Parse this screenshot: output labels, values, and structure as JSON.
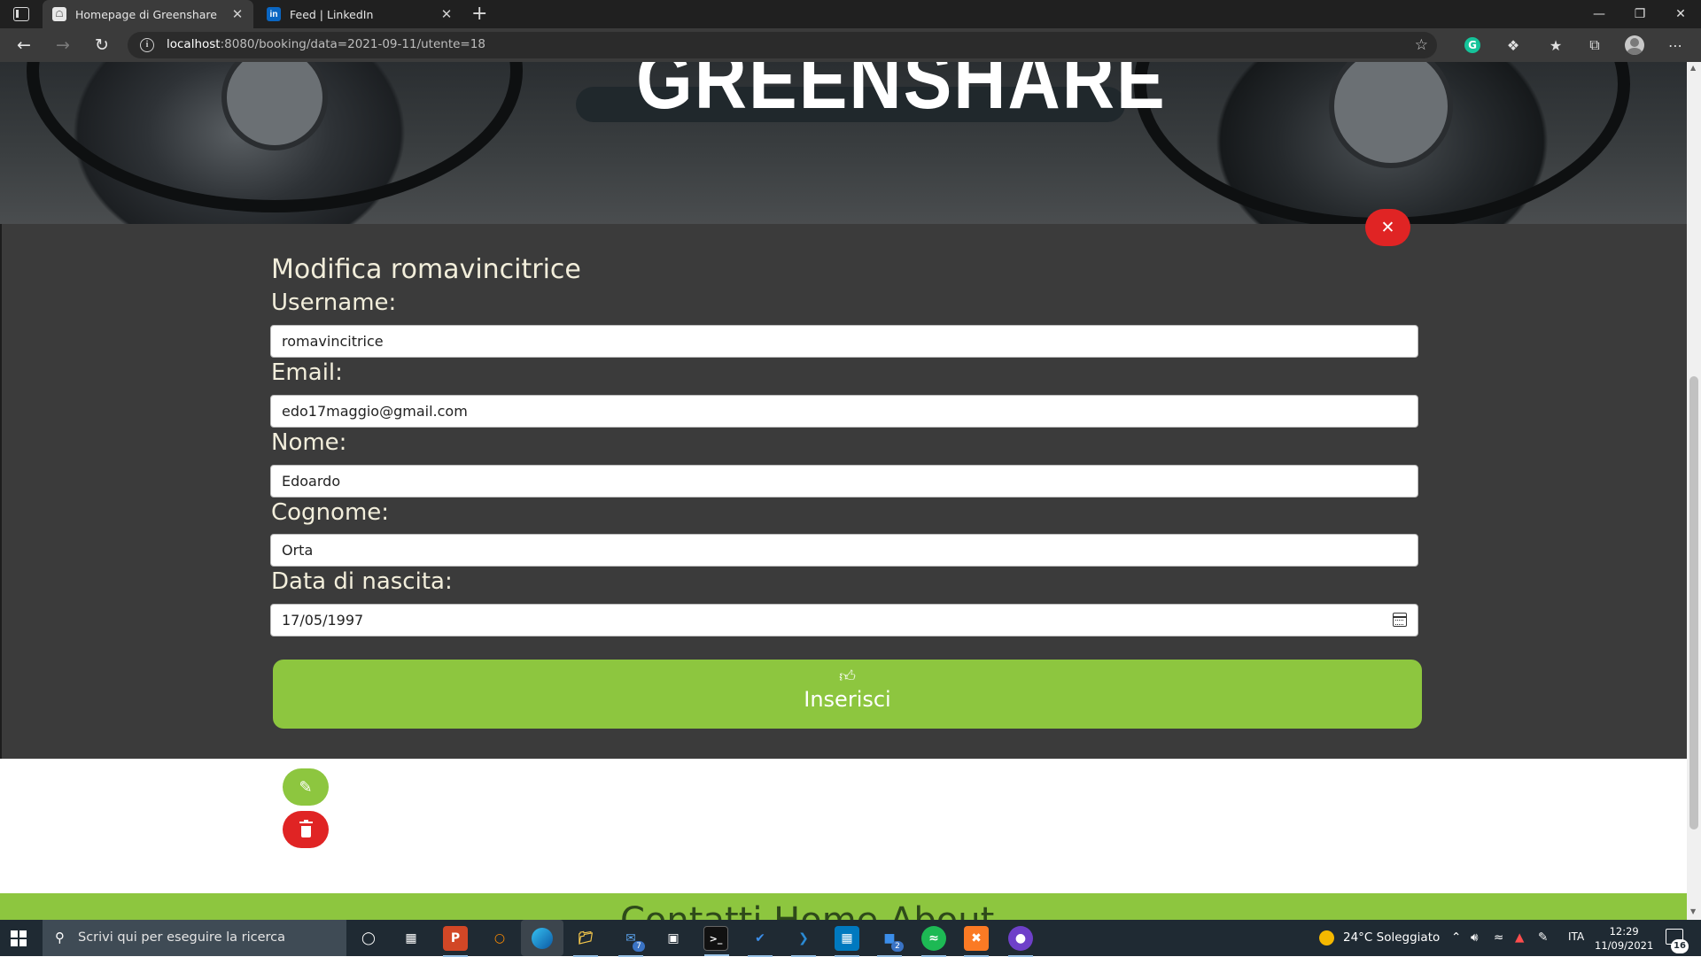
{
  "browser": {
    "tabs": [
      {
        "title": "Homepage di Greenshare",
        "favicon": "greenshare-icon",
        "active": true
      },
      {
        "title": "Feed | LinkedIn",
        "favicon": "linkedin-icon",
        "active": false
      }
    ],
    "favicon_linkedin_text": "in",
    "address": {
      "host": "localhost",
      "rest": ":8080/booking/data=2021-09-11/utente=18"
    }
  },
  "hero": {
    "brand": "GREENSHARE"
  },
  "form": {
    "title": "Modifica romavincitrice",
    "fields": [
      {
        "label": "Username:",
        "value": "romavincitrice"
      },
      {
        "label": "Email:",
        "value": "edo17maggio@gmail.com"
      },
      {
        "label": "Nome:",
        "value": "Edoardo"
      },
      {
        "label": "Cognome:",
        "value": "Orta"
      },
      {
        "label": "Data di nascita:",
        "value": "17/05/1997"
      }
    ],
    "submit_label": "Inserisci",
    "close_icon": "close-icon",
    "submit_icon": "thumbs-up-icon"
  },
  "row_actions": {
    "edit_icon": "edit-icon",
    "delete_icon": "trash-icon"
  },
  "footer": {
    "text": "Contatti   Home   About"
  },
  "taskbar": {
    "search_placeholder": "Scrivi qui per eseguire la ricerca",
    "weather": "24°C  Soleggiato",
    "language": "ITA",
    "time": "12:29",
    "date": "11/09/2021",
    "mail_badge": "7",
    "notification_count": "16",
    "badge_2": "2"
  },
  "colors": {
    "accent_green": "#8dc63f",
    "danger_red": "#e02424",
    "panel_bg": "#3b3b3b",
    "label_color": "#f2eedb"
  }
}
